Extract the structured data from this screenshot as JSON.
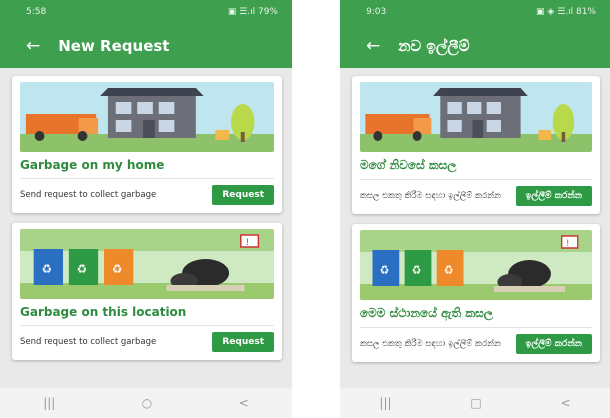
{
  "screen_en": {
    "status_time": "5:58",
    "status_icons": "▣ ☰.ıl 79%",
    "title": "New Request",
    "cards": [
      {
        "title": "Garbage on my home",
        "description": "Send request to collect garbage",
        "button": "Request",
        "illustration": "garbage-truck-house-illustration"
      },
      {
        "title": "Garbage on this location",
        "description": "Send request to collect garbage",
        "button": "Request",
        "illustration": "recycle-bins-illustration"
      }
    ],
    "nav": {
      "recents": "|||",
      "home": "○",
      "back": "<"
    }
  },
  "screen_si": {
    "status_time": "9:03",
    "status_icons": "▣ ◈ ☰.ıl 81%",
    "title": "නව ඉල්ලීම්",
    "cards": [
      {
        "title": "මගේ නිවසේ කසල",
        "description": "කසල එකතු කිරීම සඳහා ඉල්ලීම් කරන්න",
        "button": "ඉල්ලීම් කරන්න",
        "illustration": "garbage-truck-house-illustration"
      },
      {
        "title": "මෙම ස්ථානයේ ඇති කසල",
        "description": "කසල එකතු කිරීම සඳහා ඉල්ලීම් කරන්න",
        "button": "ඉල්ලීම් කරන්න",
        "illustration": "recycle-bins-illustration"
      }
    ],
    "nav": {
      "recents": "|||",
      "home": "□",
      "back": "<"
    }
  },
  "colors": {
    "primary": "#3e9f4f",
    "title_green": "#2e8b3e",
    "button": "#2f9a45"
  }
}
